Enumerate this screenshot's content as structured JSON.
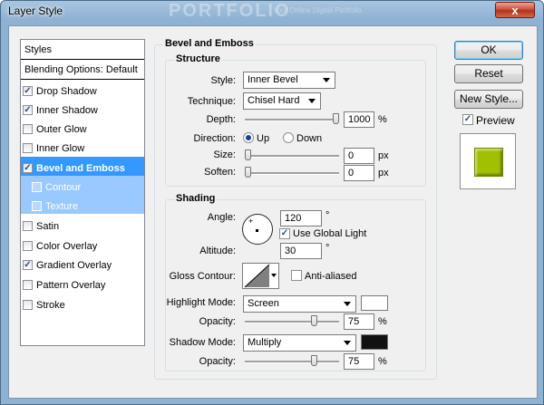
{
  "window": {
    "title": "Layer Style",
    "watermark": "PORTFOLIO",
    "watermark_sub": "Your Online Digital Portfolio",
    "close_label": "x"
  },
  "styles_panel": {
    "header": "Styles",
    "blending": "Blending Options: Default",
    "items": [
      {
        "label": "Drop Shadow",
        "checked": true
      },
      {
        "label": "Inner Shadow",
        "checked": true
      },
      {
        "label": "Outer Glow",
        "checked": false
      },
      {
        "label": "Inner Glow",
        "checked": false
      },
      {
        "label": "Bevel and Emboss",
        "checked": true,
        "selected": true
      },
      {
        "label": "Contour",
        "checked": false,
        "sub": true
      },
      {
        "label": "Texture",
        "checked": false,
        "sub": true
      },
      {
        "label": "Satin",
        "checked": false
      },
      {
        "label": "Color Overlay",
        "checked": false
      },
      {
        "label": "Gradient Overlay",
        "checked": true
      },
      {
        "label": "Pattern Overlay",
        "checked": false
      },
      {
        "label": "Stroke",
        "checked": false
      }
    ]
  },
  "bevel": {
    "title": "Bevel and Emboss",
    "structure": {
      "title": "Structure",
      "style_label": "Style:",
      "style_value": "Inner Bevel",
      "technique_label": "Technique:",
      "technique_value": "Chisel Hard",
      "depth_label": "Depth:",
      "depth_value": "1000",
      "depth_unit": "%",
      "direction_label": "Direction:",
      "dir_up": "Up",
      "dir_down": "Down",
      "size_label": "Size:",
      "size_value": "0",
      "size_unit": "px",
      "soften_label": "Soften:",
      "soften_value": "0",
      "soften_unit": "px"
    },
    "shading": {
      "title": "Shading",
      "angle_label": "Angle:",
      "angle_value": "120",
      "angle_unit": "°",
      "global_light": "Use Global Light",
      "altitude_label": "Altitude:",
      "altitude_value": "30",
      "altitude_unit": "°",
      "gloss_label": "Gloss Contour:",
      "antialiased": "Anti-aliased",
      "highlight_label": "Highlight Mode:",
      "highlight_value": "Screen",
      "highlight_color": "#ffffff",
      "opacity1_label": "Opacity:",
      "opacity1_value": "75",
      "opacity1_unit": "%",
      "shadow_label": "Shadow Mode:",
      "shadow_value": "Multiply",
      "shadow_color": "#111111",
      "opacity2_label": "Opacity:",
      "opacity2_value": "75",
      "opacity2_unit": "%"
    }
  },
  "buttons": {
    "ok": "OK",
    "reset": "Reset",
    "new_style": "New Style...",
    "preview": "Preview"
  },
  "colors": {
    "accent": "#3399ff",
    "swatch": "#a0c000"
  }
}
